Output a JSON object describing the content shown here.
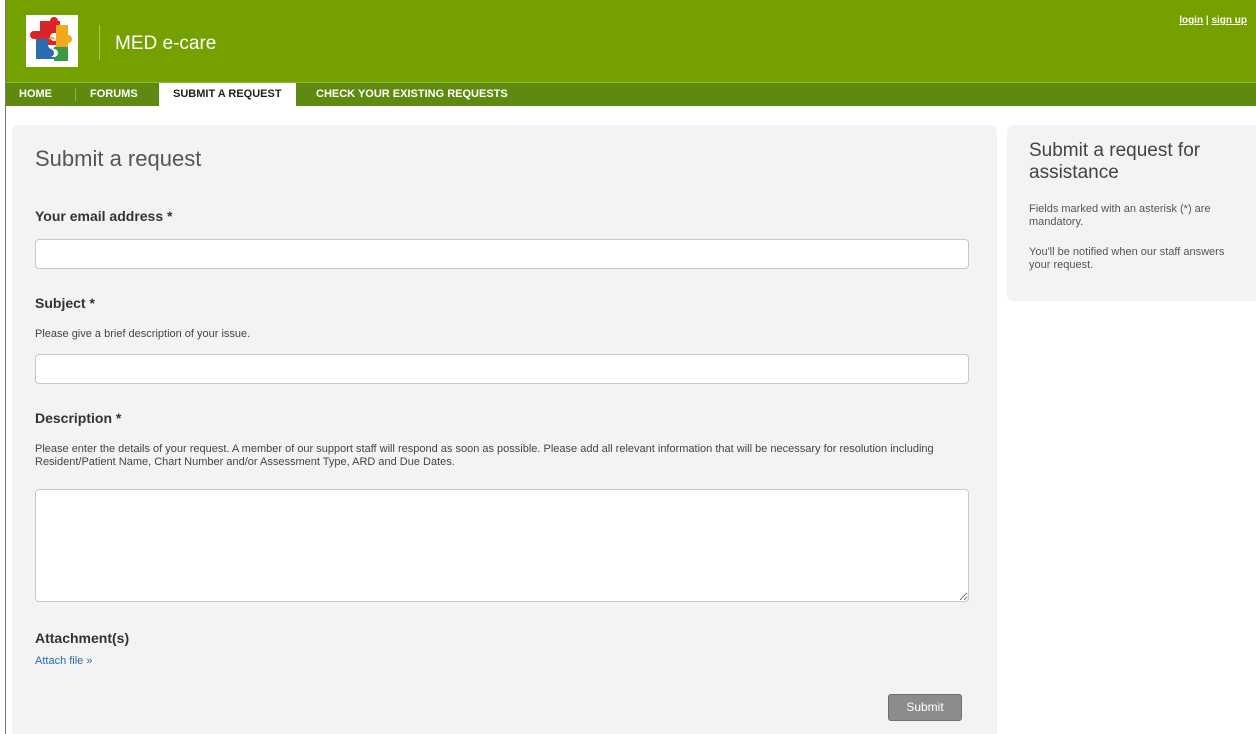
{
  "header": {
    "site_title": "MED e-care",
    "login_label": "login",
    "auth_separator": " | ",
    "signup_label": "sign up",
    "brand_color": "#74a100"
  },
  "nav": {
    "items": [
      {
        "label": "HOME",
        "active": false
      },
      {
        "label": "FORUMS",
        "active": false
      },
      {
        "label": "SUBMIT A REQUEST",
        "active": true
      },
      {
        "label": "CHECK YOUR EXISTING REQUESTS",
        "active": false
      }
    ]
  },
  "form": {
    "title": "Submit a request",
    "email": {
      "label": "Your email address *",
      "value": ""
    },
    "subject": {
      "label": "Subject *",
      "help": "Please give a brief description of your issue.",
      "value": ""
    },
    "description": {
      "label": "Description *",
      "help": "Please enter the details of your request. A member of our support staff will respond as soon as possible. Please add all relevant information that will be necessary for resolution including Resident/Patient Name, Chart Number and/or Assessment Type, ARD and Due Dates.",
      "value": ""
    },
    "attachments": {
      "label": "Attachment(s)",
      "link": "Attach file »"
    },
    "submit_label": "Submit"
  },
  "sidebar": {
    "title": "Submit a request for assistance",
    "note_mandatory": "Fields marked with an asterisk (*) are mandatory.",
    "note_notify": "You'll be notified when our staff answers your request."
  }
}
